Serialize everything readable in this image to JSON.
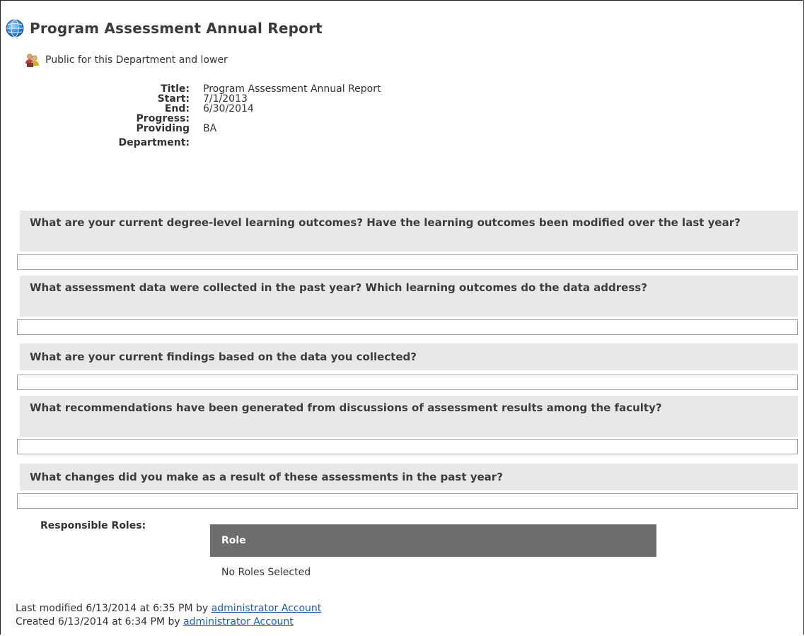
{
  "header": {
    "icon": "globe-icon",
    "title": "Program Assessment Annual Report"
  },
  "visibility": {
    "icon": "people-icon",
    "text": "Public for this Department and lower"
  },
  "details": {
    "title_label": "Title:",
    "title_value": "Program Assessment Annual Report",
    "start_label": "Start:",
    "start_value": "7/1/2013",
    "end_label": "End:",
    "end_value": "6/30/2014",
    "progress_label": "Progress:",
    "progress_value": "",
    "providing_label_line1": "Providing",
    "providing_label_line2": "Department:",
    "providing_value": "BA"
  },
  "questions": [
    {
      "text": "What are your current degree-level learning outcomes? Have the learning outcomes been modified over the last year?",
      "answer": ""
    },
    {
      "text": "What assessment data were collected in the past year? Which learning outcomes do the data address?",
      "answer": ""
    },
    {
      "text": "What are your current findings based on the data you collected?",
      "answer": ""
    },
    {
      "text": "What recommendations have been generated from discussions of assessment results among the faculty?",
      "answer": ""
    },
    {
      "text": "What changes did you make as a result of these assessments in the past year?",
      "answer": ""
    }
  ],
  "roles": {
    "label": "Responsible Roles:",
    "column_header": "Role",
    "empty_text": "No Roles Selected"
  },
  "footer": {
    "modified_prefix": "Last modified 6/13/2014 at 6:35 PM by",
    "modified_by": "administrator Account",
    "created_prefix": "Created 6/13/2014 at 6:34 PM by",
    "created_by": "administrator Account"
  },
  "colors": {
    "question_bg": "#e8e8e8",
    "role_header_bg": "#6d6d6d",
    "link": "#1f5fb0"
  }
}
